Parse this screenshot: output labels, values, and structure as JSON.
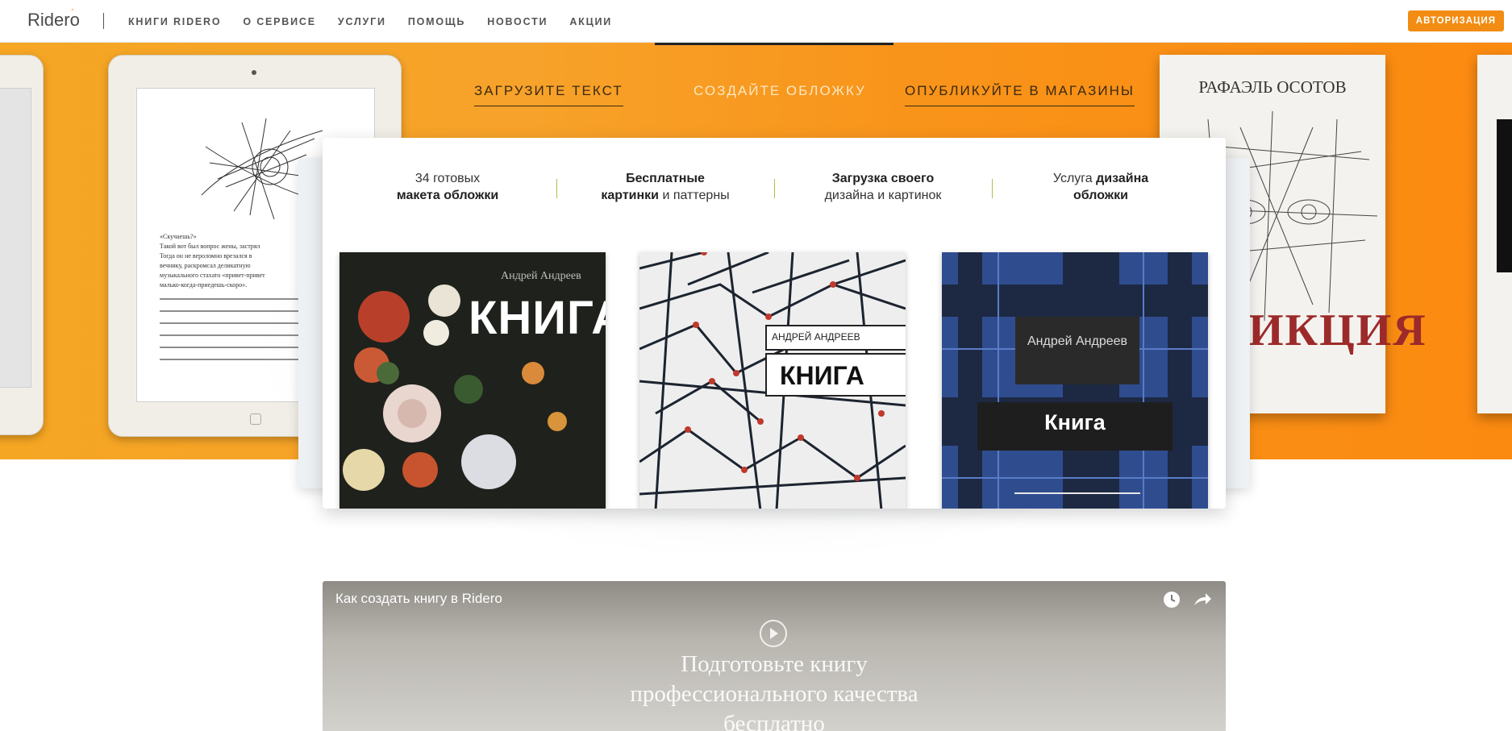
{
  "header": {
    "logo": "Ridero",
    "nav": [
      "КНИГИ RIDERO",
      "О СЕРВИСЕ",
      "УСЛУГИ",
      "ПОМОЩЬ",
      "НОВОСТИ",
      "АКЦИИ"
    ],
    "auth_label": "АВТОРИЗАЦИЯ"
  },
  "hero": {
    "steps": [
      "ЗАГРУЗИТЕ ТЕКСТ",
      "СОЗДАЙТЕ ОБЛОЖКУ",
      "ОПУБЛИКУЙТЕ В МАГАЗИНЫ"
    ],
    "ipad_text": [
      "«Скучаешь?»",
      "Такой вот был вопрос жены, застрял",
      "Тогда он не вероломно врезался в",
      "вечнику, раскромсал деликатную",
      "музыкального стахато «привет-привет",
      "малько-когда-приедешь-скоро»."
    ],
    "right_book_author": "РАФАЭЛЬ ОСОТОВ",
    "right_book_title": "ИКЦИЯ"
  },
  "features": [
    {
      "line1": "34 готовых",
      "line2_bold": "макета обложки"
    },
    {
      "line1_bold": "Бесплатные",
      "line2_bold": "картинки",
      "line2_rest": " и паттерны"
    },
    {
      "line1_bold": "Загрузка своего",
      "line2": "дизайна и картинок"
    },
    {
      "line1": "Услуга ",
      "line1_bold": "дизайна",
      "line2_bold": "обложки"
    }
  ],
  "covers": [
    {
      "author": "Андрей Андреев",
      "title": "КНИГА"
    },
    {
      "author": "АНДРЕЙ АНДРЕЕВ",
      "title": "КНИГА"
    },
    {
      "author": "Андрей Андреев",
      "title": "Книга"
    }
  ],
  "video": {
    "title": "Как создать книгу в Ridero",
    "headline": [
      "Подготовьте книгу",
      "профессионального качества",
      "бесплатно"
    ]
  },
  "colors": {
    "accent": "#f28c12",
    "hero_orange": "#f7a22a",
    "feature_divider": "#a4c64a"
  }
}
